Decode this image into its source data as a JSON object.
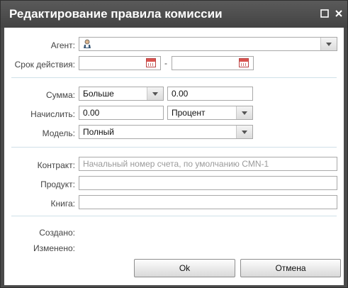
{
  "window": {
    "title": "Редактирование правила комиссии",
    "maximize_glyph": "☐",
    "close_glyph": "✕"
  },
  "fields": {
    "agent_label": "Агент:",
    "validity_label": "Срок действия:",
    "date_separator": "-",
    "date_from_value": "",
    "date_to_value": "",
    "amount_label": "Сумма:",
    "amount_operator": "Больше",
    "amount_value": "0.00",
    "accrue_label": "Начислить:",
    "accrue_value": "0.00",
    "accrue_unit": "Процент",
    "model_label": "Модель:",
    "model_value": "Полный",
    "contract_label": "Контракт:",
    "contract_placeholder": "Начальный номер счета, по умолчанию CMN-1",
    "contract_value": "",
    "product_label": "Продукт:",
    "product_value": "",
    "book_label": "Книга:",
    "book_value": ""
  },
  "meta": {
    "created_label": "Создано:",
    "modified_label": "Изменено:"
  },
  "buttons": {
    "ok_label": "Ok",
    "cancel_label": "Отмена"
  },
  "icons": {
    "agent": "agent-person-icon",
    "calendar": "calendar-icon",
    "dropdown": "chevron-down-icon"
  }
}
